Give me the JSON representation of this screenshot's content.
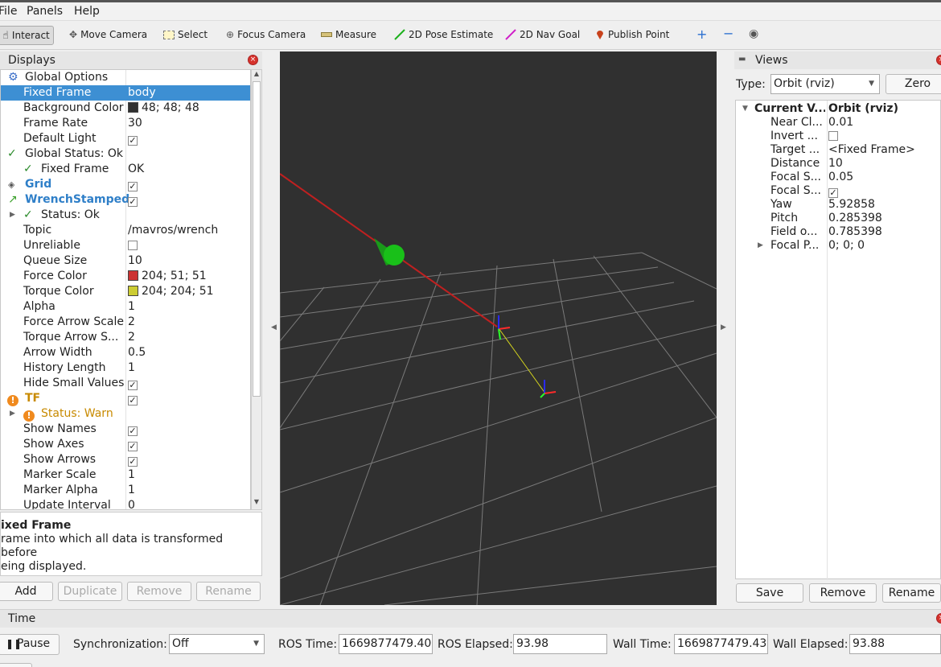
{
  "menu": {
    "file": "File",
    "panels": "Panels",
    "help": "Help"
  },
  "toolbar": {
    "interact": "Interact",
    "move_camera": "Move Camera",
    "select": "Select",
    "focus_camera": "Focus Camera",
    "measure": "Measure",
    "pose_estimate": "2D Pose Estimate",
    "nav_goal": "2D Nav Goal",
    "publish_point": "Publish Point"
  },
  "displays": {
    "title": "Displays",
    "rows": [
      {
        "label": "Global Options"
      },
      {
        "label": "Fixed Frame",
        "value": "body"
      },
      {
        "label": "Background Color",
        "value": "48; 48; 48",
        "swatch": "#303030"
      },
      {
        "label": "Frame Rate",
        "value": "30"
      },
      {
        "label": "Default Light"
      },
      {
        "label": "Global Status: Ok"
      },
      {
        "label": "Fixed Frame",
        "value": "OK"
      },
      {
        "label": "Grid"
      },
      {
        "label": "WrenchStamped"
      },
      {
        "label": "Status: Ok"
      },
      {
        "label": "Topic",
        "value": "/mavros/wrench"
      },
      {
        "label": "Unreliable"
      },
      {
        "label": "Queue Size",
        "value": "10"
      },
      {
        "label": "Force Color",
        "value": "204; 51; 51",
        "swatch": "#cc3333"
      },
      {
        "label": "Torque Color",
        "value": "204; 204; 51",
        "swatch": "#cccc33"
      },
      {
        "label": "Alpha",
        "value": "1"
      },
      {
        "label": "Force Arrow Scale",
        "value": "2"
      },
      {
        "label": "Torque Arrow S...",
        "value": "2"
      },
      {
        "label": "Arrow Width",
        "value": "0.5"
      },
      {
        "label": "History Length",
        "value": "1"
      },
      {
        "label": "Hide Small Values"
      },
      {
        "label": "TF"
      },
      {
        "label": "Status: Warn"
      },
      {
        "label": "Show Names"
      },
      {
        "label": "Show Axes"
      },
      {
        "label": "Show Arrows"
      },
      {
        "label": "Marker Scale",
        "value": "1"
      },
      {
        "label": "Marker Alpha",
        "value": "1"
      },
      {
        "label": "Update Interval",
        "value": "0"
      }
    ],
    "desc_title": "ixed Frame",
    "desc_line1": "rame into which all data is transformed before",
    "desc_line2": "eing displayed.",
    "buttons": {
      "add": "Add",
      "duplicate": "Duplicate",
      "remove": "Remove",
      "rename": "Rename"
    }
  },
  "views": {
    "title": "Views",
    "type_label": "Type:",
    "type_value": "Orbit (rviz)",
    "zero": "Zero",
    "rows": [
      {
        "label": "Current V...",
        "value": "Orbit (rviz)"
      },
      {
        "label": "Near Cl...",
        "value": "0.01"
      },
      {
        "label": "Invert ..."
      },
      {
        "label": "Target ...",
        "value": "<Fixed Frame>"
      },
      {
        "label": "Distance",
        "value": "10"
      },
      {
        "label": "Focal S...",
        "value": "0.05"
      },
      {
        "label": "Focal S..."
      },
      {
        "label": "Yaw",
        "value": "5.92858"
      },
      {
        "label": "Pitch",
        "value": "0.285398"
      },
      {
        "label": "Field o...",
        "value": "0.785398"
      },
      {
        "label": "Focal P...",
        "value": "0; 0; 0"
      }
    ],
    "buttons": {
      "save": "Save",
      "remove": "Remove",
      "rename": "Rename"
    }
  },
  "time": {
    "title": "Time",
    "pause": "Pause",
    "sync_label": "Synchronization:",
    "sync_value": "Off",
    "ros_time_label": "ROS Time:",
    "ros_time": "1669877479.40",
    "ros_elapsed_label": "ROS Elapsed:",
    "ros_elapsed": "93.98",
    "wall_time_label": "Wall Time:",
    "wall_time": "1669877479.43",
    "wall_elapsed_label": "Wall Elapsed:",
    "wall_elapsed": "93.88"
  },
  "colors": {
    "selection": "#3d8fd3",
    "viewport_bg": "#303030",
    "display_link": "#2f7fc8",
    "warn": "#c88a00"
  }
}
